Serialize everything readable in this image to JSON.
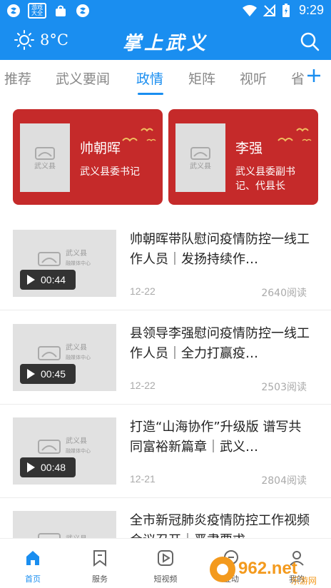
{
  "status_bar": {
    "app_badge": "游戏大全",
    "time": "9:29"
  },
  "header": {
    "temperature": "8°C",
    "brand": "掌上武义"
  },
  "tabs": [
    {
      "label": "推荐",
      "active": false
    },
    {
      "label": "武义要闻",
      "active": false
    },
    {
      "label": "政情",
      "active": true
    },
    {
      "label": "矩阵",
      "active": false
    },
    {
      "label": "视听",
      "active": false
    },
    {
      "label": "省",
      "active": false
    }
  ],
  "leaders": [
    {
      "name": "帅朝晖",
      "title": "武义县委书记"
    },
    {
      "name": "李强",
      "title": "武义县委副书记、代县长"
    }
  ],
  "placeholder_logo": {
    "line1": "武义县",
    "line2": "融媒体中心"
  },
  "news": [
    {
      "title": "帅朝晖带队慰问疫情防控一线工作人员｜发扬持续作…",
      "duration": "00:44",
      "date": "12-22",
      "reads": "2640阅读"
    },
    {
      "title": "县领导李强慰问疫情防控一线工作人员｜全力打赢疫…",
      "duration": "00:45",
      "date": "12-22",
      "reads": "2503阅读"
    },
    {
      "title": "打造“山海协作”升级版 谱写共同富裕新篇章｜武义…",
      "duration": "00:48",
      "date": "12-21",
      "reads": "2804阅读"
    },
    {
      "title": "全市新冠肺炎疫情防控工作视频会议召开｜严肃要求…",
      "duration": "",
      "date": "",
      "reads": ""
    }
  ],
  "bottom_nav": [
    {
      "label": "首页",
      "icon": "home-icon",
      "active": true
    },
    {
      "label": "服务",
      "icon": "bookmark-icon",
      "active": false
    },
    {
      "label": "短视频",
      "icon": "play-icon",
      "active": false
    },
    {
      "label": "互动",
      "icon": "chat-icon",
      "active": false
    },
    {
      "label": "我的",
      "icon": "user-icon",
      "active": false
    }
  ],
  "watermark": {
    "text": "962.net",
    "subtext": "乐游网"
  },
  "colors": {
    "primary": "#1a8ef0",
    "card_red": "#c52a2a",
    "thumb_gray": "#e1e1e1"
  }
}
